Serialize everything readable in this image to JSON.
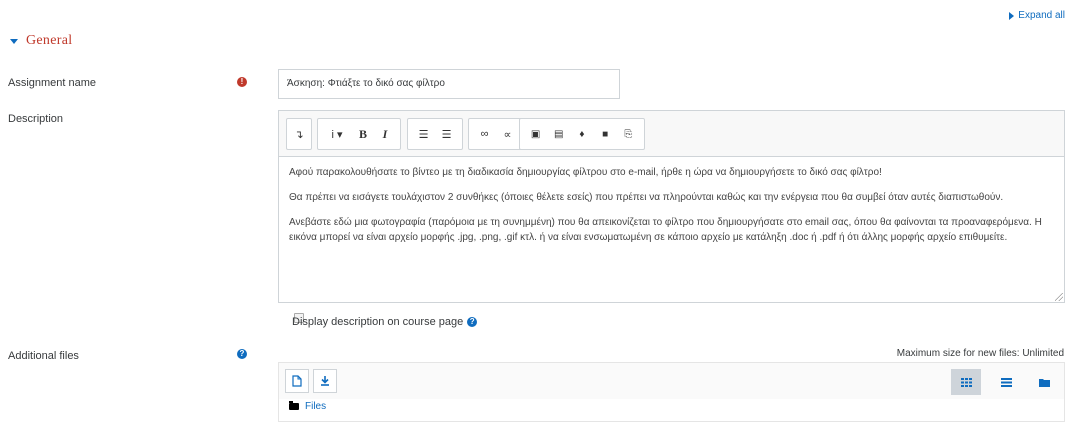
{
  "header": {
    "expand_all": "Expand all",
    "section_title": "General"
  },
  "assignment": {
    "label": "Assignment name",
    "required_icon": "!",
    "value": "Άσκηση: Φτιάξτε το δικό σας φίλτρο"
  },
  "description": {
    "label": "Description",
    "paragraphs": [
      "Αφού παρακολουθήσατε το βίντεο με τη διαδικασία δημιουργίας φίλτρου στο e-mail, ήρθε η ώρα να δημιουργήσετε το δικό σας φίλτρο!",
      "Θα πρέπει να εισάγετε τουλάχιστον 2 συνθήκες (όποιες θέλετε εσείς) που πρέπει να πληρούνται καθώς και την ενέργεια που θα συμβεί όταν  αυτές διαπιστωθούν.",
      "Ανεβάστε εδώ μια φωτογραφία (παρόμοια με τη συνημμένη) που θα απεικονίζεται το φίλτρο που δημιουργήσατε στο email σας, όπου θα φαίνονται τα προαναφερόμενα. Η εικόνα μπορεί να είναι αρχείο μορφής .jpg, .png, .gif κτλ. ή να είναι ενσωματωμένη σε κάποιο αρχείο με κατάληξη .doc ή .pdf ή ότι άλλης μορφής αρχείο επιθυμείτε."
    ],
    "toolbar": {
      "toggle": "↴",
      "info": "i ▾",
      "bold": "B",
      "italic": "I",
      "ul": "☰",
      "ol": "☰",
      "link": "∞",
      "unlink": "∝",
      "image": "▣",
      "media": "▤",
      "mic": "♦",
      "video": "■",
      "copy": "⎘"
    },
    "display_checkbox_label": "Display description on course page",
    "display_checked": false
  },
  "additional_files": {
    "label": "Additional files",
    "max_size": "Maximum size for new files: Unlimited",
    "folder_label": "Files",
    "view_mode": "icons"
  },
  "colors": {
    "accent": "#0f6cbf",
    "section": "#c0392b",
    "required": "#c0392b"
  }
}
